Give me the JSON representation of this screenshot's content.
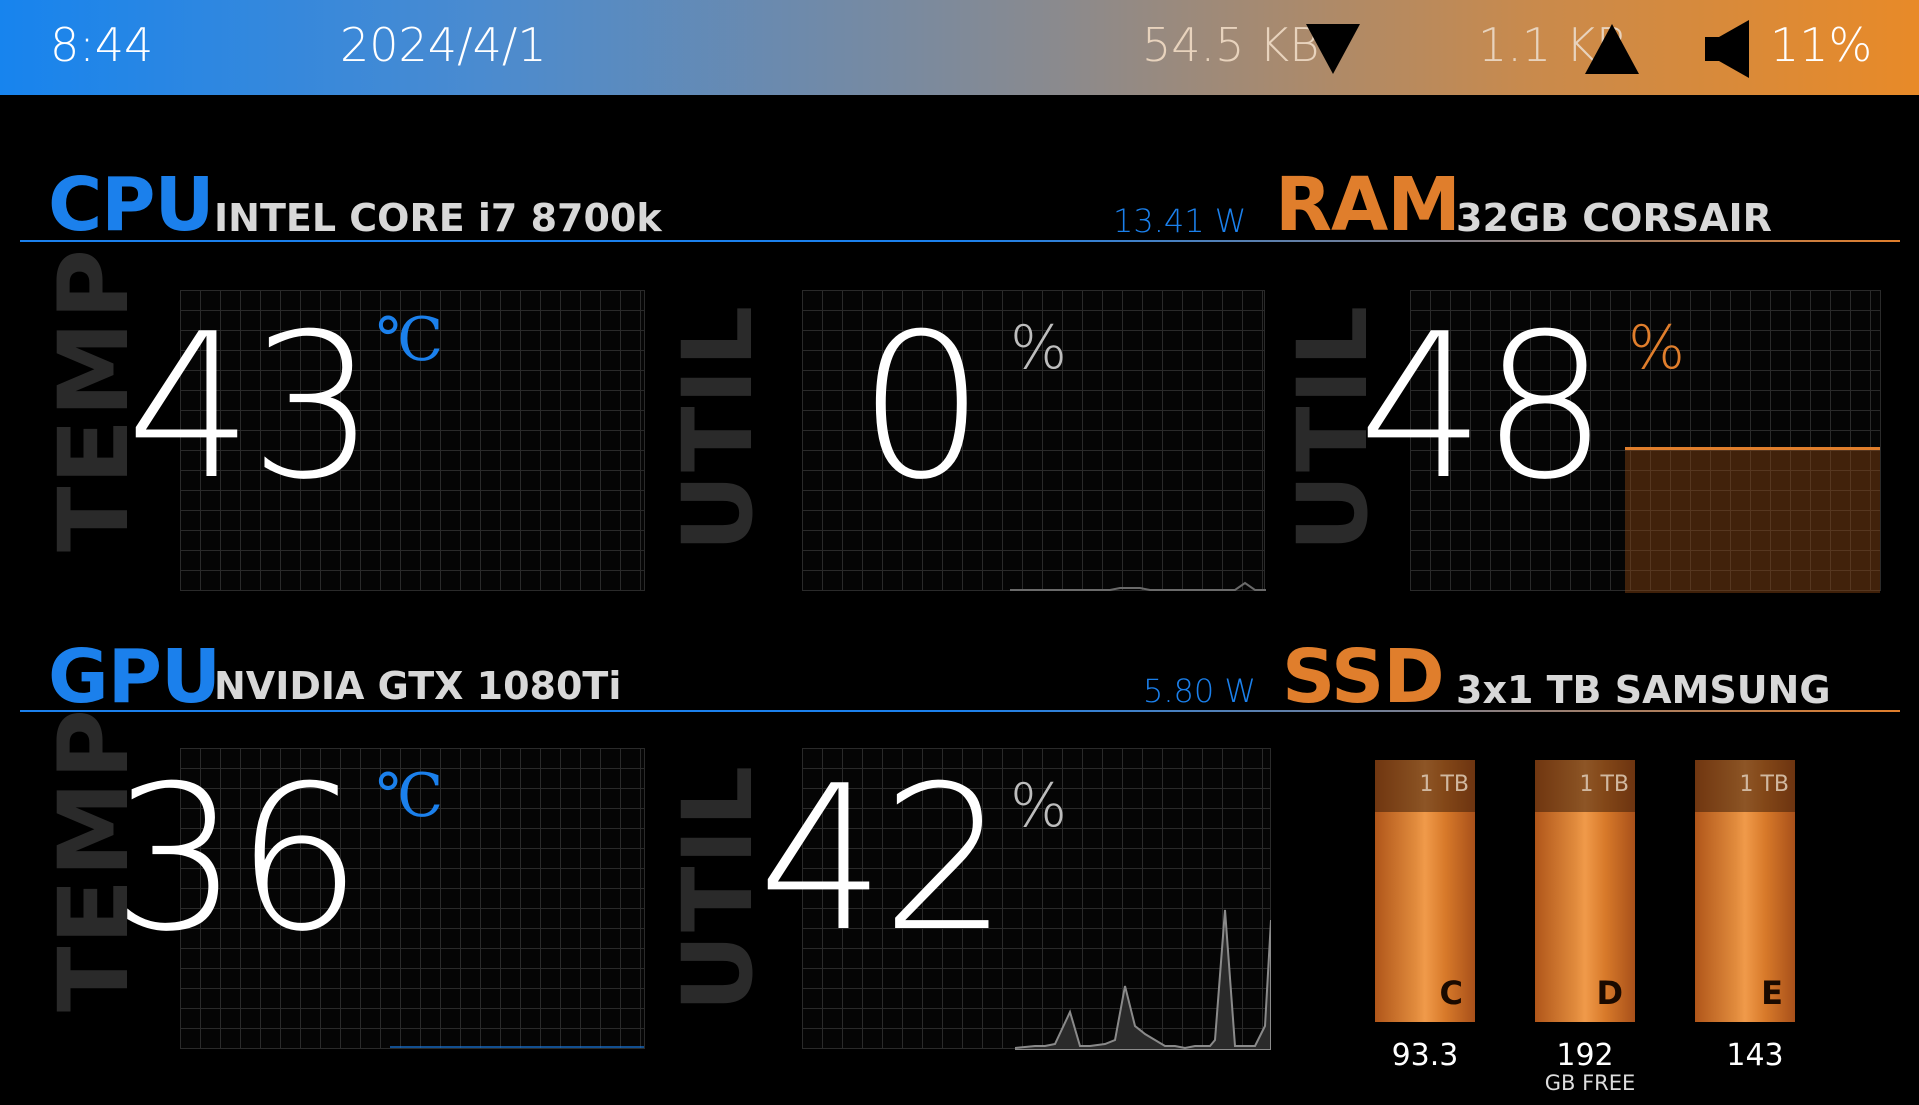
{
  "topbar": {
    "time": "8:44",
    "date": "2024/4/1",
    "net_down": "54.5 KB",
    "net_up": "1.1 KB",
    "volume": "11%"
  },
  "cpu": {
    "title": "CPU",
    "model": "INTEL CORE i7 8700k",
    "power": "13.41 W",
    "temp_label": "TEMP",
    "temp_value": "43",
    "temp_unit": "℃",
    "util_label": "UTIL",
    "util_value": "0",
    "util_unit": "%"
  },
  "ram": {
    "title": "RAM",
    "model": "32GB CORSAIR",
    "util_label": "UTIL",
    "util_value": "48",
    "util_unit": "%"
  },
  "gpu": {
    "title": "GPU",
    "model": "NVIDIA GTX 1080Ti",
    "power": "5.80 W",
    "temp_label": "TEMP",
    "temp_value": "36",
    "temp_unit": "℃",
    "util_label": "UTIL",
    "util_value": "42",
    "util_unit": "%"
  },
  "ssd": {
    "title": "SSD",
    "model": "3x1 TB SAMSUNG",
    "drives": [
      {
        "capacity": "1 TB",
        "letter": "C",
        "free": "93.3"
      },
      {
        "capacity": "1 TB",
        "letter": "D",
        "free": "192"
      },
      {
        "capacity": "1 TB",
        "letter": "E",
        "free": "143"
      }
    ],
    "free_unit": "GB FREE"
  },
  "colors": {
    "accent_blue": "#1b80ec",
    "accent_orange": "#e07e2c",
    "background": "#000000"
  },
  "icons": [
    "download-arrow-icon",
    "upload-arrow-icon",
    "speaker-icon"
  ]
}
